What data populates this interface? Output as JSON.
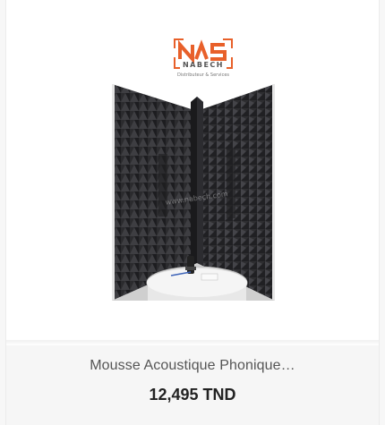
{
  "logo": {
    "brand_text": "NABECH",
    "tagline": "Distributeur & Services"
  },
  "product": {
    "image_watermark": "www.nabech.com",
    "title": "Mousse Acoustique Phonique…",
    "price": "12,495 TND"
  },
  "colors": {
    "logo_orange": "#e8602a",
    "price_text": "#222222",
    "title_text": "#555555",
    "info_bg": "#f6f6f6"
  }
}
